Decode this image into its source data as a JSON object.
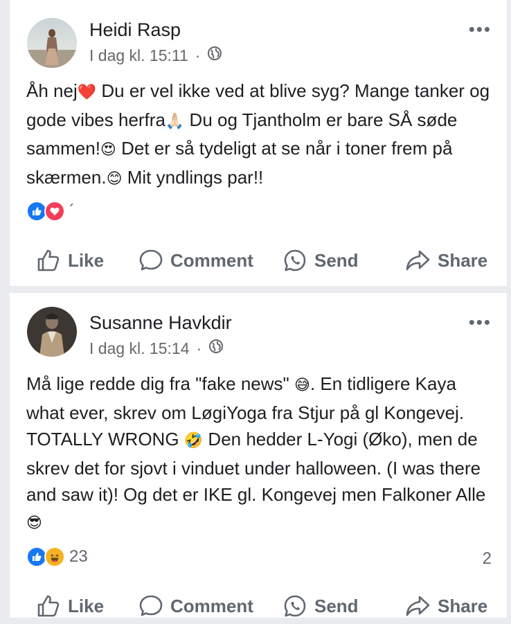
{
  "posts": [
    {
      "author": "Heidi Rasp",
      "timestamp": "I dag kl. 15:11",
      "separator": "·",
      "privacy_icon": "globe-icon",
      "text_parts": [
        "Åh nej",
        "❤️",
        " Du er vel ikke ved at blive syg? Mange tanker og gode vibes herfra",
        "🙏🏻",
        " Du og Tjantholm er bare SÅ søde sammen!",
        "😍",
        " Det er så tydeligt at se når i toner frem på skærmen.",
        "😊",
        " Mit yndlings par!!"
      ],
      "reactions": [
        "like",
        "love"
      ],
      "reaction_count": "´",
      "comment_count": "",
      "actions": {
        "like": "Like",
        "comment": "Comment",
        "send": "Send",
        "share": "Share"
      }
    },
    {
      "author": "Susanne Havkdir",
      "timestamp": "I dag kl. 15:14",
      "separator": "·",
      "privacy_icon": "globe-icon",
      "text_parts": [
        "Må lige redde dig fra \"fake news\" ",
        "😅",
        ". En tidligere Kaya what ever, skrev om LøgiYoga fra Stjur på gl Kongevej. TOTALLY WRONG ",
        "🤣",
        " Den hedder L-Yogi (Øko), men de skrev det for sjovt i vinduet under halloween. (I was there and saw it)! Og det er IKE gl. Kongevej men Falkoner Alle",
        "😎"
      ],
      "reactions": [
        "like",
        "haha"
      ],
      "reaction_count": "23",
      "comment_count": "2",
      "actions": {
        "like": "Like",
        "comment": "Comment",
        "send": "Send",
        "share": "Share"
      }
    }
  ],
  "colors": {
    "background": "#e9ebee",
    "card": "#ffffff",
    "text": "#1c1e21",
    "secondary": "#65676b",
    "action": "#606770",
    "like_blue": "#1877f2",
    "love_red": "#f33e58",
    "haha_yellow": "#f7b125"
  }
}
